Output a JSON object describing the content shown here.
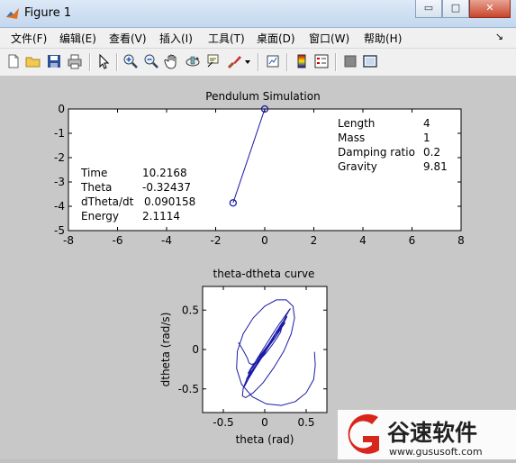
{
  "window": {
    "title": "Figure 1"
  },
  "window_buttons": {
    "minimize": "▭",
    "maximize": "□",
    "close": "✕"
  },
  "menu": [
    "文件(F)",
    "编辑(E)",
    "查看(V)",
    "插入(I)",
    "工具(T)",
    "桌面(D)",
    "窗口(W)",
    "帮助(H)"
  ],
  "menu_overflow": "↘",
  "toolbar_icons": [
    "new-figure-icon",
    "open-file-icon",
    "save-icon",
    "print-icon",
    "pointer-icon",
    "zoom-in-icon",
    "zoom-out-icon",
    "pan-icon",
    "rotate-3d-icon",
    "data-cursor-icon",
    "brush-icon",
    "brush-dropdown-icon",
    "link-plot-icon",
    "colorbar-icon",
    "legend-icon",
    "hide-plot-tools-icon",
    "show-plot-tools-icon"
  ],
  "chart_data": [
    {
      "type": "line",
      "title": "Pendulum Simulation",
      "xlim": [
        -8,
        8
      ],
      "ylim": [
        -5,
        0
      ],
      "xticks": [
        "-8",
        "-6",
        "-4",
        "-2",
        "0",
        "2",
        "4",
        "6",
        "8"
      ],
      "yticks": [
        "0",
        "-1",
        "-2",
        "-3",
        "-4",
        "-5"
      ],
      "pivot": [
        0,
        0
      ],
      "bob": [
        -1.29,
        -3.86
      ],
      "info_left": [
        {
          "label": "Time",
          "value": "10.2168"
        },
        {
          "label": "Theta",
          "value": "-0.32437"
        },
        {
          "label": "dTheta/dt",
          "value": "0.090158"
        },
        {
          "label": "Energy",
          "value": "2.1114"
        }
      ],
      "info_right": [
        {
          "label": "Length",
          "value": "4"
        },
        {
          "label": "Mass",
          "value": "1"
        },
        {
          "label": "Damping ratio",
          "value": "0.2"
        },
        {
          "label": "Gravity",
          "value": "9.81"
        }
      ],
      "colors": {
        "line": "#1a1aa8",
        "background": "#ffffff"
      }
    },
    {
      "type": "line",
      "title": "theta-dtheta curve",
      "xlabel": "theta (rad)",
      "ylabel": "dtheta (rad/s)",
      "xlim": [
        -0.75,
        0.75
      ],
      "ylim": [
        -0.8,
        0.8
      ],
      "xticks": [
        "-0.5",
        "0",
        "0.5"
      ],
      "yticks": [
        "0.5",
        "0",
        "-0.5"
      ],
      "series": [
        {
          "x": [
            0.6,
            0.61,
            0.59,
            0.5,
            0.37,
            0.2,
            0.02,
            -0.15,
            -0.28,
            -0.34,
            -0.33,
            -0.26,
            -0.14,
            0.0,
            0.14,
            0.26,
            0.34,
            0.36,
            0.32,
            0.23,
            0.11,
            -0.02,
            -0.14,
            -0.23,
            -0.27,
            -0.26,
            -0.2,
            -0.1,
            0.02,
            0.14,
            0.24,
            0.3,
            0.31,
            0.27,
            0.2,
            0.1,
            -0.01,
            -0.12,
            -0.2,
            -0.24,
            -0.25,
            -0.22,
            -0.16,
            -0.07,
            0.03,
            0.13,
            0.21,
            0.26,
            0.27,
            0.24,
            0.17,
            0.08,
            -0.02,
            -0.11,
            -0.18,
            -0.22,
            -0.22,
            -0.19,
            -0.13,
            -0.04,
            0.05,
            0.14,
            0.2,
            0.24,
            0.24,
            0.21,
            0.15,
            0.07,
            -0.02,
            -0.1,
            -0.16,
            -0.19,
            -0.2,
            -0.18,
            -0.13,
            -0.06,
            0.02,
            0.09,
            0.15,
            0.19,
            0.2,
            0.19,
            0.15,
            0.09,
            0.02,
            -0.05,
            -0.11,
            -0.16,
            -0.19,
            -0.21,
            -0.25,
            -0.3,
            -0.32
          ],
          "y": [
            -0.03,
            -0.2,
            -0.38,
            -0.55,
            -0.66,
            -0.71,
            -0.69,
            -0.6,
            -0.44,
            -0.24,
            -0.02,
            0.2,
            0.4,
            0.55,
            0.63,
            0.63,
            0.55,
            0.4,
            0.2,
            -0.02,
            -0.23,
            -0.42,
            -0.55,
            -0.61,
            -0.59,
            -0.49,
            -0.33,
            -0.13,
            0.07,
            0.27,
            0.42,
            0.51,
            0.52,
            0.45,
            0.31,
            0.13,
            -0.06,
            -0.24,
            -0.38,
            -0.46,
            -0.47,
            -0.41,
            -0.29,
            -0.13,
            0.04,
            0.21,
            0.34,
            0.41,
            0.42,
            0.36,
            0.25,
            0.1,
            -0.05,
            -0.2,
            -0.31,
            -0.37,
            -0.38,
            -0.33,
            -0.23,
            -0.1,
            0.04,
            0.17,
            0.27,
            0.33,
            0.34,
            0.3,
            0.21,
            0.09,
            -0.04,
            -0.16,
            -0.25,
            -0.3,
            -0.3,
            -0.26,
            -0.18,
            -0.08,
            0.03,
            0.13,
            0.21,
            0.25,
            0.26,
            0.22,
            0.15,
            0.06,
            -0.04,
            -0.12,
            -0.17,
            -0.19,
            -0.17,
            -0.11,
            -0.03,
            0.06,
            0.09
          ]
        }
      ],
      "colors": {
        "line": "#1a1aa8",
        "background": "#ffffff"
      }
    }
  ],
  "watermark": {
    "cn": "谷速软件",
    "url": "www.gususoft.com"
  }
}
